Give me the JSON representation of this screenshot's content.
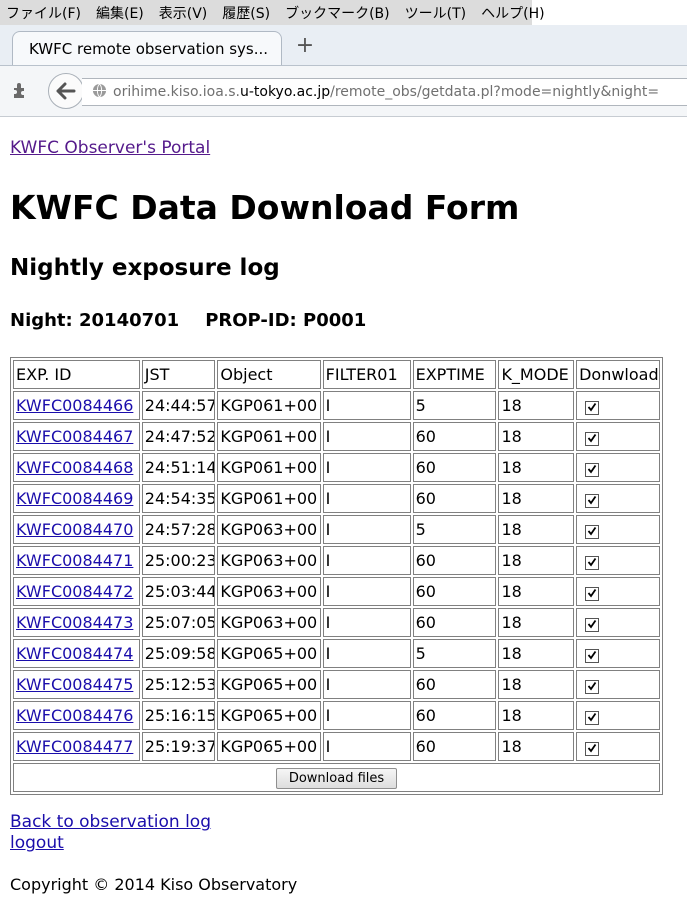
{
  "menu": [
    "ファイル(F)",
    "編集(E)",
    "表示(V)",
    "履歴(S)",
    "ブックマーク(B)",
    "ツール(T)",
    "ヘルプ(H)"
  ],
  "tab": {
    "title": "KWFC remote observation sys...",
    "new_tab": "+"
  },
  "url": {
    "prefix": "orihime.kiso.ioa.s.",
    "domain": "u-tokyo.ac.jp",
    "path": "/remote_obs/getdata.pl?mode=nightly&night="
  },
  "page": {
    "portal_link": "KWFC Observer's Portal",
    "title": "KWFC Data Download Form",
    "subtitle": "Nightly exposure log",
    "night_label": "Night: 20140701",
    "propid_label": "PROP-ID: P0001",
    "download_button": "Download files",
    "back_link": "Back to observation log",
    "logout_link": "logout",
    "copyright": "Copyright © 2014 Kiso Observatory"
  },
  "table": {
    "headers": [
      "EXP. ID",
      "JST",
      "Object",
      "FILTER01",
      "EXPTIME",
      "K_MODE",
      "Donwload"
    ],
    "rows": [
      {
        "id": "KWFC0084466",
        "jst": "24:44:57",
        "object": "KGP061+00",
        "filter": "I",
        "exptime": "5",
        "kmode": "18",
        "checked": true
      },
      {
        "id": "KWFC0084467",
        "jst": "24:47:52",
        "object": "KGP061+00",
        "filter": "I",
        "exptime": "60",
        "kmode": "18",
        "checked": true
      },
      {
        "id": "KWFC0084468",
        "jst": "24:51:14",
        "object": "KGP061+00",
        "filter": "I",
        "exptime": "60",
        "kmode": "18",
        "checked": true
      },
      {
        "id": "KWFC0084469",
        "jst": "24:54:35",
        "object": "KGP061+00",
        "filter": "I",
        "exptime": "60",
        "kmode": "18",
        "checked": true
      },
      {
        "id": "KWFC0084470",
        "jst": "24:57:28",
        "object": "KGP063+00",
        "filter": "I",
        "exptime": "5",
        "kmode": "18",
        "checked": true
      },
      {
        "id": "KWFC0084471",
        "jst": "25:00:23",
        "object": "KGP063+00",
        "filter": "I",
        "exptime": "60",
        "kmode": "18",
        "checked": true
      },
      {
        "id": "KWFC0084472",
        "jst": "25:03:44",
        "object": "KGP063+00",
        "filter": "I",
        "exptime": "60",
        "kmode": "18",
        "checked": true
      },
      {
        "id": "KWFC0084473",
        "jst": "25:07:05",
        "object": "KGP063+00",
        "filter": "I",
        "exptime": "60",
        "kmode": "18",
        "checked": true
      },
      {
        "id": "KWFC0084474",
        "jst": "25:09:58",
        "object": "KGP065+00",
        "filter": "I",
        "exptime": "5",
        "kmode": "18",
        "checked": true
      },
      {
        "id": "KWFC0084475",
        "jst": "25:12:53",
        "object": "KGP065+00",
        "filter": "I",
        "exptime": "60",
        "kmode": "18",
        "checked": true
      },
      {
        "id": "KWFC0084476",
        "jst": "25:16:15",
        "object": "KGP065+00",
        "filter": "I",
        "exptime": "60",
        "kmode": "18",
        "checked": true
      },
      {
        "id": "KWFC0084477",
        "jst": "25:19:37",
        "object": "KGP065+00",
        "filter": "I",
        "exptime": "60",
        "kmode": "18",
        "checked": true
      }
    ]
  },
  "icons": {
    "back": "back-arrow-icon",
    "site": "globe-icon",
    "addon": "puzzle-icon",
    "check": "checkmark-icon"
  }
}
